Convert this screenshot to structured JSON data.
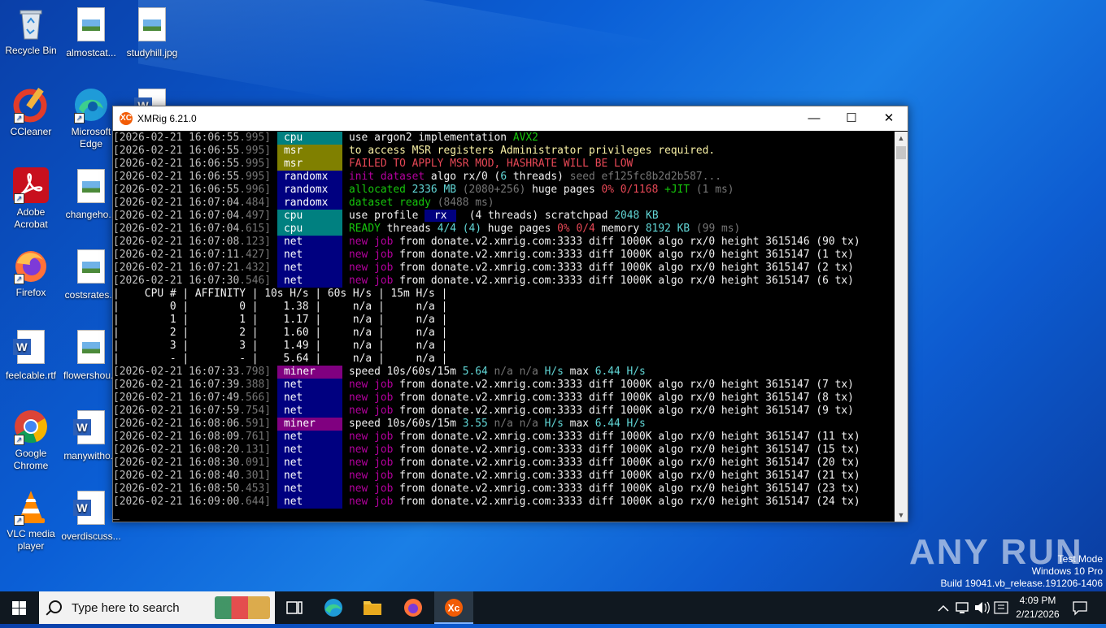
{
  "desktop": {
    "icons": [
      {
        "label": "Recycle Bin"
      },
      {
        "label": "almostcat..."
      },
      {
        "label": "studyhill.jpg"
      },
      {
        "label": "CCleaner"
      },
      {
        "label": "Microsoft Edge"
      },
      {
        "label": "Adobe Acrobat"
      },
      {
        "label": "changeho..."
      },
      {
        "label": "Firefox"
      },
      {
        "label": "costsrates..."
      },
      {
        "label": "feelcable.rtf"
      },
      {
        "label": "flowershou..."
      },
      {
        "label": "Google Chrome"
      },
      {
        "label": "manywitho..."
      },
      {
        "label": "VLC media player"
      },
      {
        "label": "overdiscuss..."
      }
    ]
  },
  "window": {
    "title": "XMRig 6.21.0",
    "app_icon": "XC",
    "minimize_icon": "minimize-icon",
    "maximize_icon": "maximize-icon",
    "close_icon": "close-icon"
  },
  "console": {
    "log1": [
      {
        "date": "[2026-02-21 16:06:55",
        "ms": ".995]",
        "tag": "cpu",
        "tagclass": "t-cpu",
        "parts": [
          [
            "w",
            "use "
          ],
          [
            "w",
            "argon2"
          ],
          [
            "w",
            " implementation "
          ],
          [
            "g",
            "AVX2"
          ]
        ]
      },
      {
        "date": "[2026-02-21 16:06:55",
        "ms": ".995]",
        "tag": "msr",
        "tagclass": "t-msr",
        "parts": [
          [
            "y",
            "to access MSR registers Administrator privileges required."
          ]
        ]
      },
      {
        "date": "[2026-02-21 16:06:55",
        "ms": ".995]",
        "tag": "msr",
        "tagclass": "t-msr",
        "parts": [
          [
            "r",
            "FAILED TO APPLY MSR MOD, HASHRATE WILL BE LOW"
          ]
        ]
      },
      {
        "date": "[2026-02-21 16:06:55",
        "ms": ".995]",
        "tag": "randomx",
        "tagclass": "t-rx",
        "parts": [
          [
            "m",
            "init dataset"
          ],
          [
            "w",
            " algo "
          ],
          [
            "w",
            "rx/0"
          ],
          [
            "w",
            " ("
          ],
          [
            "c",
            "6"
          ],
          [
            "w",
            " threads)"
          ],
          [
            "gr",
            " seed ef125fc8b2d2b587..."
          ]
        ]
      },
      {
        "date": "[2026-02-21 16:06:55",
        "ms": ".996]",
        "tag": "randomx",
        "tagclass": "t-rx",
        "parts": [
          [
            "g",
            "allocated "
          ],
          [
            "c",
            "2336 MB"
          ],
          [
            "gr",
            " (2080+256)"
          ],
          [
            "w",
            " huge pages "
          ],
          [
            "r",
            "0% 0/1168"
          ],
          [
            "g",
            " +JIT"
          ],
          [
            "gr",
            " (1 ms)"
          ]
        ]
      },
      {
        "date": "[2026-02-21 16:07:04",
        "ms": ".484]",
        "tag": "randomx",
        "tagclass": "t-rx",
        "parts": [
          [
            "g",
            "dataset ready"
          ],
          [
            "gr",
            " (8488 ms)"
          ]
        ]
      },
      {
        "date": "[2026-02-21 16:07:04",
        "ms": ".497]",
        "tag": "cpu",
        "tagclass": "t-cpu",
        "parts": [
          [
            "w",
            "use profile "
          ],
          [
            "rx",
            " rx "
          ],
          [
            "w",
            "  (4 threads) scratchpad "
          ],
          [
            "c",
            "2048 KB"
          ]
        ]
      },
      {
        "date": "[2026-02-21 16:07:04",
        "ms": ".615]",
        "tag": "cpu",
        "tagclass": "t-cpu",
        "parts": [
          [
            "g",
            "READY"
          ],
          [
            "w",
            " threads "
          ],
          [
            "c",
            "4/4 (4)"
          ],
          [
            "w",
            " huge pages "
          ],
          [
            "r",
            "0% 0/4"
          ],
          [
            "w",
            " memory "
          ],
          [
            "c",
            "8192 KB"
          ],
          [
            "gr",
            " (99 ms)"
          ]
        ]
      },
      {
        "date": "[2026-02-21 16:07:08",
        "ms": ".123]",
        "tag": "net",
        "tagclass": "t-net",
        "parts": [
          [
            "mb",
            "new job"
          ],
          [
            "w",
            " from donate.v2.xmrig.com:3333 diff 1000K algo rx/0 height 3615146 (90 tx)"
          ]
        ]
      },
      {
        "date": "[2026-02-21 16:07:11",
        "ms": ".427]",
        "tag": "net",
        "tagclass": "t-net",
        "parts": [
          [
            "mb",
            "new job"
          ],
          [
            "w",
            " from donate.v2.xmrig.com:3333 diff 1000K algo rx/0 height 3615147 (1 tx)"
          ]
        ]
      },
      {
        "date": "[2026-02-21 16:07:21",
        "ms": ".432]",
        "tag": "net",
        "tagclass": "t-net",
        "parts": [
          [
            "mb",
            "new job"
          ],
          [
            "w",
            " from donate.v2.xmrig.com:3333 diff 1000K algo rx/0 height 3615147 (2 tx)"
          ]
        ]
      },
      {
        "date": "[2026-02-21 16:07:30",
        "ms": ".546]",
        "tag": "net",
        "tagclass": "t-net",
        "parts": [
          [
            "mb",
            "new job"
          ],
          [
            "w",
            " from donate.v2.xmrig.com:3333 diff 1000K algo rx/0 height 3615147 (6 tx)"
          ]
        ]
      }
    ],
    "table": [
      "|    CPU # | AFFINITY | 10s H/s | 60s H/s | 15m H/s |",
      "|        0 |        0 |    1.38 |     n/a |     n/a |",
      "|        1 |        1 |    1.17 |     n/a |     n/a |",
      "|        2 |        2 |    1.60 |     n/a |     n/a |",
      "|        3 |        3 |    1.49 |     n/a |     n/a |",
      "|        - |        - |    5.64 |     n/a |     n/a |"
    ],
    "log2": [
      {
        "date": "[2026-02-21 16:07:33",
        "ms": ".798]",
        "tag": "miner",
        "tagclass": "t-miner",
        "parts": [
          [
            "w",
            "speed 10s/60s/15m "
          ],
          [
            "c",
            "5.64"
          ],
          [
            "gr",
            " n/a n/a"
          ],
          [
            "c",
            " H/s"
          ],
          [
            "w",
            " max "
          ],
          [
            "c",
            "6.44 H/s"
          ]
        ]
      },
      {
        "date": "[2026-02-21 16:07:39",
        "ms": ".388]",
        "tag": "net",
        "tagclass": "t-net",
        "parts": [
          [
            "mb",
            "new job"
          ],
          [
            "w",
            " from donate.v2.xmrig.com:3333 diff 1000K algo rx/0 height 3615147 (7 tx)"
          ]
        ]
      },
      {
        "date": "[2026-02-21 16:07:49",
        "ms": ".566]",
        "tag": "net",
        "tagclass": "t-net",
        "parts": [
          [
            "mb",
            "new job"
          ],
          [
            "w",
            " from donate.v2.xmrig.com:3333 diff 1000K algo rx/0 height 3615147 (8 tx)"
          ]
        ]
      },
      {
        "date": "[2026-02-21 16:07:59",
        "ms": ".754]",
        "tag": "net",
        "tagclass": "t-net",
        "parts": [
          [
            "mb",
            "new job"
          ],
          [
            "w",
            " from donate.v2.xmrig.com:3333 diff 1000K algo rx/0 height 3615147 (9 tx)"
          ]
        ]
      },
      {
        "date": "[2026-02-21 16:08:06",
        "ms": ".591]",
        "tag": "miner",
        "tagclass": "t-miner",
        "parts": [
          [
            "w",
            "speed 10s/60s/15m "
          ],
          [
            "c",
            "3.55"
          ],
          [
            "gr",
            " n/a n/a"
          ],
          [
            "c",
            " H/s"
          ],
          [
            "w",
            " max "
          ],
          [
            "c",
            "6.44 H/s"
          ]
        ]
      },
      {
        "date": "[2026-02-21 16:08:09",
        "ms": ".761]",
        "tag": "net",
        "tagclass": "t-net",
        "parts": [
          [
            "mb",
            "new job"
          ],
          [
            "w",
            " from donate.v2.xmrig.com:3333 diff 1000K algo rx/0 height 3615147 (11 tx)"
          ]
        ]
      },
      {
        "date": "[2026-02-21 16:08:20",
        "ms": ".131]",
        "tag": "net",
        "tagclass": "t-net",
        "parts": [
          [
            "mb",
            "new job"
          ],
          [
            "w",
            " from donate.v2.xmrig.com:3333 diff 1000K algo rx/0 height 3615147 (15 tx)"
          ]
        ]
      },
      {
        "date": "[2026-02-21 16:08:30",
        "ms": ".091]",
        "tag": "net",
        "tagclass": "t-net",
        "parts": [
          [
            "mb",
            "new job"
          ],
          [
            "w",
            " from donate.v2.xmrig.com:3333 diff 1000K algo rx/0 height 3615147 (20 tx)"
          ]
        ]
      },
      {
        "date": "[2026-02-21 16:08:40",
        "ms": ".301]",
        "tag": "net",
        "tagclass": "t-net",
        "parts": [
          [
            "mb",
            "new job"
          ],
          [
            "w",
            " from donate.v2.xmrig.com:3333 diff 1000K algo rx/0 height 3615147 (21 tx)"
          ]
        ]
      },
      {
        "date": "[2026-02-21 16:08:50",
        "ms": ".453]",
        "tag": "net",
        "tagclass": "t-net",
        "parts": [
          [
            "mb",
            "new job"
          ],
          [
            "w",
            " from donate.v2.xmrig.com:3333 diff 1000K algo rx/0 height 3615147 (23 tx)"
          ]
        ]
      },
      {
        "date": "[2026-02-21 16:09:00",
        "ms": ".644]",
        "tag": "net",
        "tagclass": "t-net",
        "parts": [
          [
            "mb",
            "new job"
          ],
          [
            "w",
            " from donate.v2.xmrig.com:3333 diff 1000K algo rx/0 height 3615147 (24 tx)"
          ]
        ]
      }
    ],
    "cursor": "_"
  },
  "watermark": {
    "brand": "ANY RUN",
    "line1": "Test Mode",
    "line2": "Windows 10 Pro",
    "line3": "Build 19041.vb_release.191206-1406"
  },
  "taskbar": {
    "search_placeholder": "Type here to search",
    "time": "4:09 PM",
    "date": "2/21/2026",
    "colors": {
      "active_underline": "#7fb2ff"
    }
  }
}
